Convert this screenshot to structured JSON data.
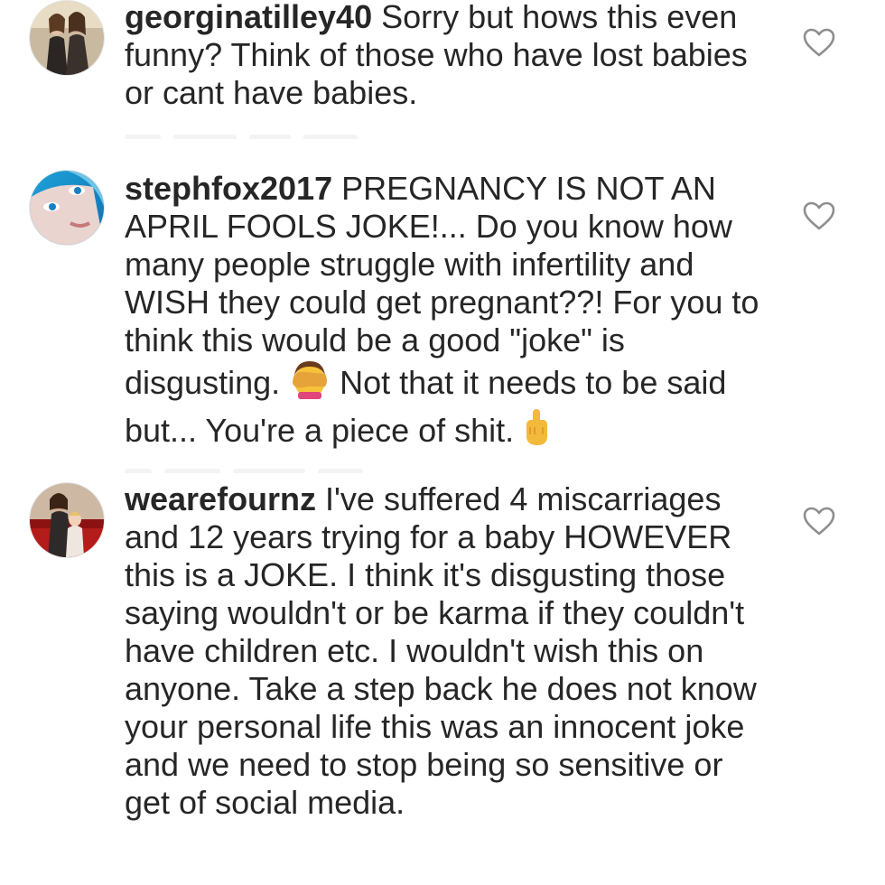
{
  "comments": [
    {
      "username": "georginatilley40",
      "text": " Sorry but hows this even funny? Think of those who have lost babies or cant have babies.",
      "avatar_icon": "avatar-two-women-photo"
    },
    {
      "username": "stephfox2017",
      "text_before": " PREGNANCY IS NOT AN APRIL FOOLS JOKE!... Do you know how many people struggle with infertility and WISH they could get pregnant??! For you to think this would be a good \"joke\" is disgusting. ",
      "emoji_1": "face-palm-emoji",
      "text_middle": " Not that it needs to be said but... You're a piece of shit. ",
      "emoji_2": "middle-finger-emoji",
      "avatar_icon": "avatar-blue-face-photo"
    },
    {
      "username": "wearefournz",
      "text": " I've suffered 4 miscarriages and 12 years trying for a baby HOWEVER this is a JOKE. I think it's disgusting those saying wouldn't or be karma if they couldn't have children etc. I wouldn't wish this on anyone. Take a step back he does not know your personal life this was an innocent joke and we need to stop being so sensitive or get of social media.",
      "avatar_icon": "avatar-family-photo"
    }
  ],
  "colors": {
    "text": "#262626",
    "heart_outline": "#8e8e8e",
    "background": "#ffffff"
  }
}
